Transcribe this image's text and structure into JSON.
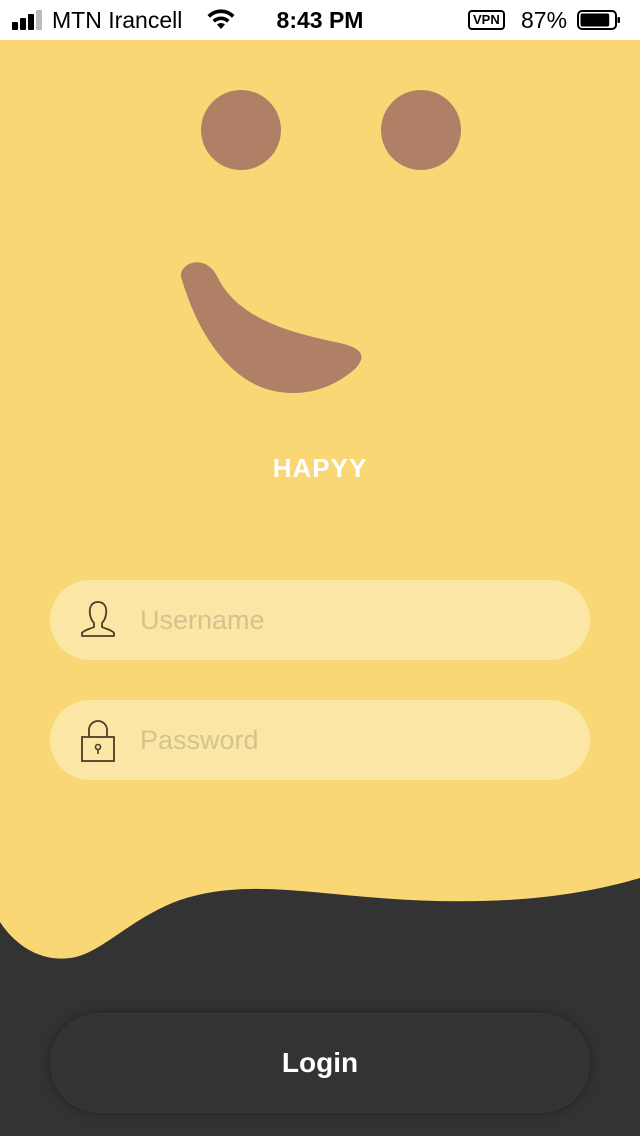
{
  "status_bar": {
    "carrier": "MTN Irancell",
    "time": "8:43 PM",
    "vpn": "VPN",
    "battery_percent": "87%",
    "battery_level": 0.87
  },
  "app": {
    "title": "HAPYY"
  },
  "login_form": {
    "username_placeholder": "Username",
    "password_placeholder": "Password",
    "username_icon": "user-icon",
    "password_icon": "lock-icon",
    "login_label": "Login"
  },
  "colors": {
    "yellow": "#f8d774",
    "field_bg": "#fbe6a6",
    "dark": "#333333",
    "face_brown": "#b08066"
  }
}
